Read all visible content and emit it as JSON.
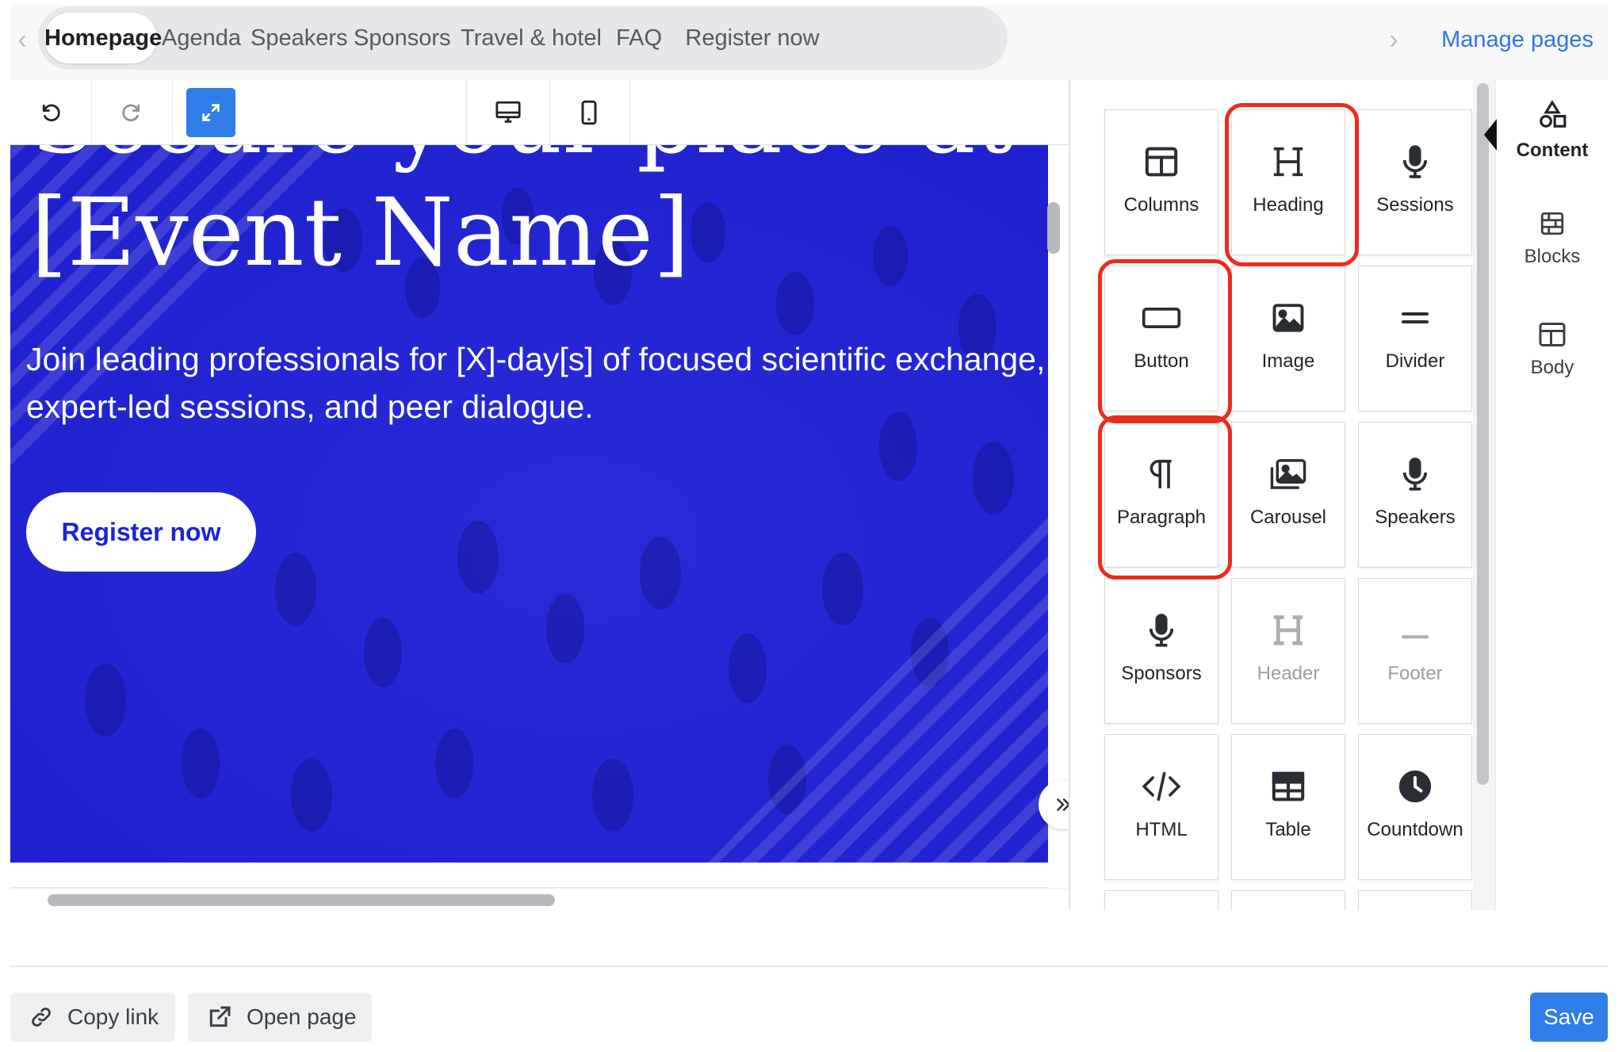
{
  "tabs": [
    {
      "label": "Homepage",
      "active": true
    },
    {
      "label": "Agenda",
      "active": false
    },
    {
      "label": "Speakers",
      "active": false
    },
    {
      "label": "Sponsors",
      "active": false
    },
    {
      "label": "Travel & hotel",
      "active": false
    },
    {
      "label": "FAQ",
      "active": false
    },
    {
      "label": "Register now",
      "active": false
    }
  ],
  "manage_pages": "Manage pages",
  "toolbar": {
    "icons": [
      "undo-icon",
      "redo-icon",
      "expand-icon",
      "desktop-icon",
      "mobile-icon"
    ],
    "expand_active_color": "#2f7de8"
  },
  "hero": {
    "title_partial": "Secure your place at",
    "title": "[Event Name]",
    "subtitle": "Join leading professionals for [X]-day[s] of focused scientific exchange, expert-led sessions, and peer dialogue.",
    "cta": "Register now",
    "overlay_color": "#2324e0",
    "cta_text_color": "#1a24d6"
  },
  "content_blocks": [
    {
      "label": "Columns",
      "icon": "columns-icon",
      "disabled": false,
      "highlighted": false
    },
    {
      "label": "Heading",
      "icon": "heading-icon",
      "disabled": false,
      "highlighted": true
    },
    {
      "label": "Sessions",
      "icon": "microphone-icon",
      "disabled": false,
      "highlighted": false
    },
    {
      "label": "Button",
      "icon": "button-icon",
      "disabled": false,
      "highlighted": true
    },
    {
      "label": "Image",
      "icon": "image-icon",
      "disabled": false,
      "highlighted": false
    },
    {
      "label": "Divider",
      "icon": "divider-icon",
      "disabled": false,
      "highlighted": false
    },
    {
      "label": "Paragraph",
      "icon": "paragraph-icon",
      "disabled": false,
      "highlighted": true
    },
    {
      "label": "Carousel",
      "icon": "carousel-icon",
      "disabled": false,
      "highlighted": false
    },
    {
      "label": "Speakers",
      "icon": "microphone-icon",
      "disabled": false,
      "highlighted": false
    },
    {
      "label": "Sponsors",
      "icon": "microphone-icon",
      "disabled": false,
      "highlighted": false
    },
    {
      "label": "Header",
      "icon": "heading-icon",
      "disabled": true,
      "highlighted": false
    },
    {
      "label": "Footer",
      "icon": "footer-icon",
      "disabled": true,
      "highlighted": false
    },
    {
      "label": "HTML",
      "icon": "code-icon",
      "disabled": false,
      "highlighted": false
    },
    {
      "label": "Table",
      "icon": "table-icon",
      "disabled": false,
      "highlighted": false
    },
    {
      "label": "Countdown",
      "icon": "clock-icon",
      "disabled": false,
      "highlighted": false
    }
  ],
  "highlight_color": "#ee2a1b",
  "right_nav": [
    {
      "label": "Content",
      "icon": "shapes-icon",
      "active": true
    },
    {
      "label": "Blocks",
      "icon": "blocks-icon",
      "active": false
    },
    {
      "label": "Body",
      "icon": "layout-icon",
      "active": false
    }
  ],
  "footer": {
    "copy_link": "Copy link",
    "open_page": "Open page",
    "save": "Save",
    "save_color": "#2f7de8"
  }
}
